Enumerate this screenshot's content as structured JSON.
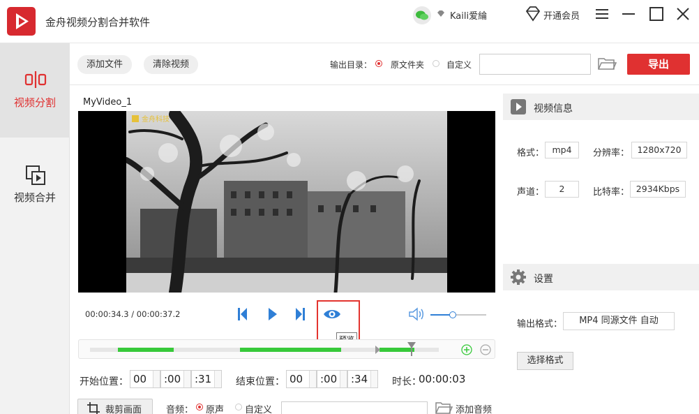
{
  "app": {
    "title": "金舟视频分割合并软件",
    "user_name": "Kaili爱綸",
    "vip_label": "开通会员"
  },
  "sidebar": {
    "items": [
      {
        "label": "视频分割",
        "active": true,
        "icon": "split-icon"
      },
      {
        "label": "视频合并",
        "active": false,
        "icon": "merge-icon"
      }
    ]
  },
  "toolbar": {
    "add_file": "添加文件",
    "clear_video": "清除视频",
    "output_dir_label": "输出目录：",
    "option_source_folder": "原文件夹",
    "option_custom": "自定义",
    "dir_value": "",
    "export_label": "导出"
  },
  "video": {
    "name": "MyVideo_1",
    "watermark": "金舟科技"
  },
  "controls": {
    "timecode": "00:00:34.3 / 00:00:37.2",
    "preview_tooltip": "预览",
    "volume_level": 0.4
  },
  "timeline": {
    "segments": [
      [
        0.08,
        0.24
      ],
      [
        0.43,
        0.72
      ],
      [
        0.83,
        0.93
      ]
    ]
  },
  "time_settings": {
    "start_label": "开始位置：",
    "start": {
      "h": "00",
      "m": ":00",
      "s": ":31"
    },
    "end_label": "结束位置：",
    "end": {
      "h": "00",
      "m": ":00",
      "s": ":34"
    },
    "duration_label": "时长：",
    "duration": "00:00:03"
  },
  "bottom": {
    "crop_label": "裁剪画面",
    "audio_label": "音频：",
    "option_original": "原声",
    "option_custom": "自定义",
    "audio_value": "",
    "add_audio": "添加音频"
  },
  "video_info": {
    "title": "视频信息",
    "format_label": "格式：",
    "format": "mp4",
    "resolution_label": "分辨率：",
    "resolution": "1280x720",
    "channels_label": "声道：",
    "channels": "2",
    "bitrate_label": "比特率：",
    "bitrate": "2934Kbps"
  },
  "settings": {
    "title": "设置",
    "output_format_label": "输出格式：",
    "output_format": "MP4 同源文件 自动",
    "select_format": "选择格式"
  },
  "colors": {
    "accent": "#e03131",
    "timeline_green": "#37c93a",
    "control_blue": "#2f7fd6"
  }
}
